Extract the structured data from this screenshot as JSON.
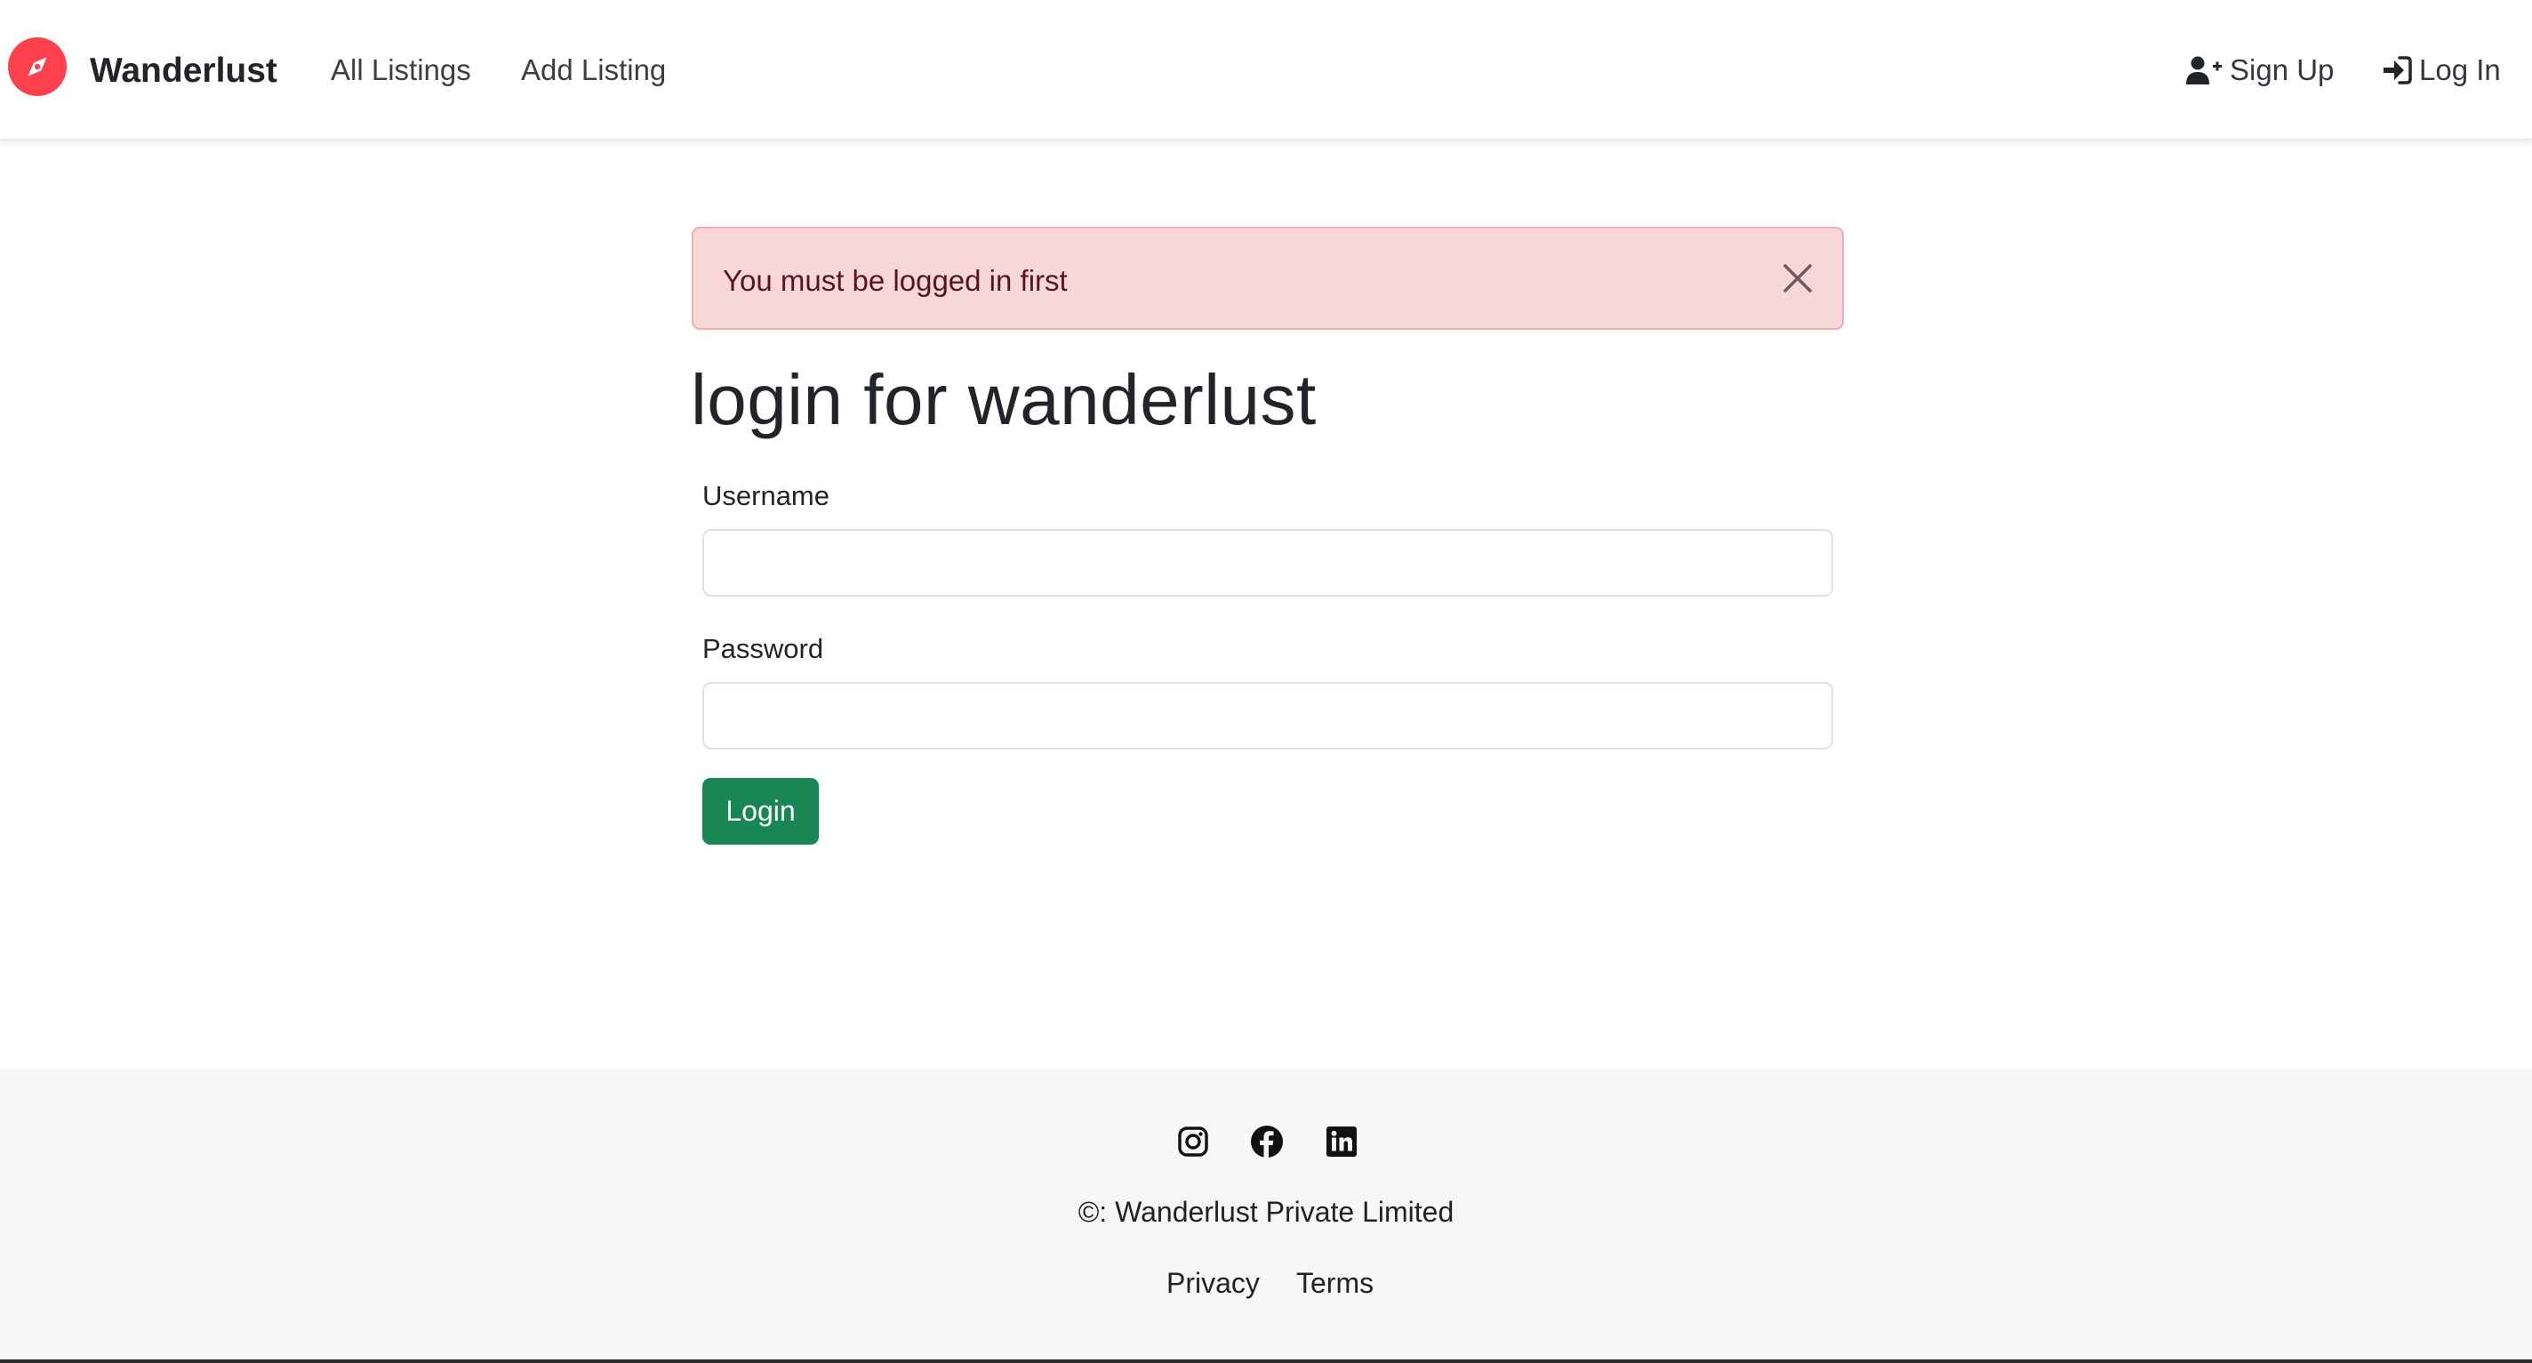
{
  "nav": {
    "brand": "Wanderlust",
    "brand_icon": "compass-icon",
    "brand_color": "#fe424d",
    "links": [
      {
        "label": "All Listings"
      },
      {
        "label": "Add Listing"
      }
    ],
    "signup": {
      "label": "Sign Up",
      "icon": "user-plus-icon"
    },
    "login": {
      "label": "Log In",
      "icon": "sign-in-icon"
    }
  },
  "alert": {
    "message": "You must be logged in first",
    "close_icon": "close-icon",
    "background": "#f8d7da",
    "text_color": "#58151c"
  },
  "form": {
    "title": "login for wanderlust",
    "username_label": "Username",
    "username_value": "",
    "password_label": "Password",
    "password_value": "",
    "submit_label": "Login",
    "submit_color": "#198754"
  },
  "footer": {
    "social_icons": [
      "instagram-icon",
      "facebook-icon",
      "linkedin-icon"
    ],
    "copyright": "©: Wanderlust Private Limited",
    "links": [
      {
        "label": "Privacy"
      },
      {
        "label": "Terms"
      }
    ]
  }
}
